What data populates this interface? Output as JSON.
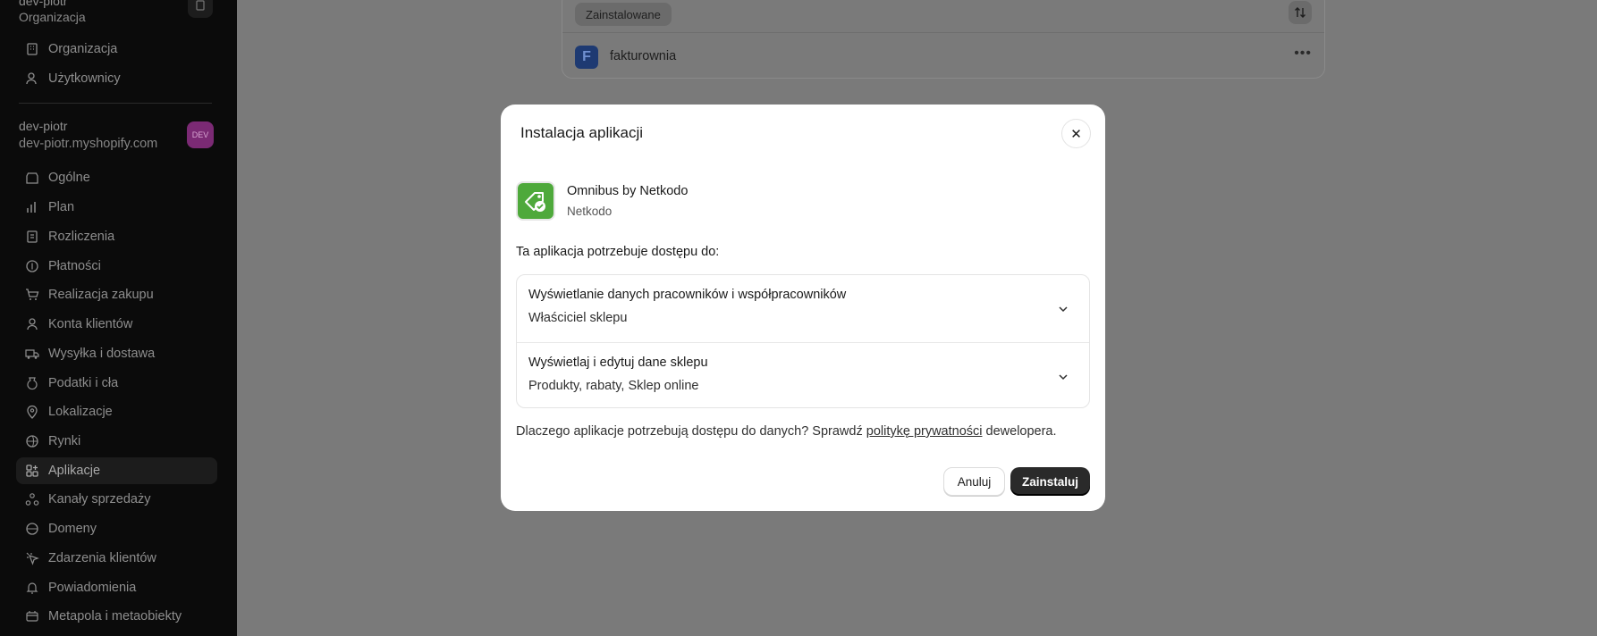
{
  "sidebar": {
    "org_name": "dev-piotr",
    "org_label": "Organizacja",
    "org_items": [
      {
        "label": "Organizacja",
        "icon": "building-icon"
      },
      {
        "label": "Użytkownicy",
        "icon": "users-icon"
      }
    ],
    "store_name": "dev-piotr",
    "store_domain": "dev-piotr.myshopify.com",
    "dev_badge": "DEV",
    "items": [
      {
        "label": "Ogólne",
        "icon": "store-icon"
      },
      {
        "label": "Plan",
        "icon": "chart-icon"
      },
      {
        "label": "Rozliczenia",
        "icon": "receipt-icon"
      },
      {
        "label": "Płatności",
        "icon": "payment-icon"
      },
      {
        "label": "Realizacja zakupu",
        "icon": "cart-icon"
      },
      {
        "label": "Konta klientów",
        "icon": "person-icon"
      },
      {
        "label": "Wysyłka i dostawa",
        "icon": "truck-icon"
      },
      {
        "label": "Podatki i cła",
        "icon": "tax-icon"
      },
      {
        "label": "Lokalizacje",
        "icon": "location-icon"
      },
      {
        "label": "Rynki",
        "icon": "globe-icon"
      },
      {
        "label": "Aplikacje",
        "icon": "apps-icon"
      },
      {
        "label": "Kanały sprzedaży",
        "icon": "channels-icon"
      },
      {
        "label": "Domeny",
        "icon": "globe-icon"
      },
      {
        "label": "Zdarzenia klientów",
        "icon": "cursor-icon"
      },
      {
        "label": "Powiadomienia",
        "icon": "bell-icon"
      },
      {
        "label": "Metapola i metaobiekty",
        "icon": "database-icon"
      }
    ]
  },
  "background": {
    "filter_pill": "Zainstalowane",
    "app_row_name": "fakturownia",
    "app_row_logo_letter": "F"
  },
  "modal": {
    "title": "Instalacja aplikacji",
    "close_symbol": "✕",
    "app_name": "Omnibus by Netkodo",
    "app_developer": "Netkodo",
    "access_heading": "Ta aplikacja potrzebuje dostępu do:",
    "permissions": [
      {
        "title": "Wyświetlanie danych pracowników i współpracowników",
        "detail": "Właściciel sklepu"
      },
      {
        "title": "Wyświetlaj i edytuj dane sklepu",
        "detail": "Produkty, rabaty, Sklep online"
      }
    ],
    "note_before": "Dlaczego aplikacje potrzebują dostępu do danych? Sprawdź ",
    "note_link": "politykę prywatności",
    "note_after": " dewelopera.",
    "cancel_label": "Anuluj",
    "install_label": "Zainstaluj"
  },
  "colors": {
    "overlay": "#7a7a7a",
    "sidebar_bg": "#0b0b0b",
    "primary_button": "#2a2a2a",
    "app_icon_green": "#4ea93b",
    "dev_badge": "#7b2a74"
  }
}
